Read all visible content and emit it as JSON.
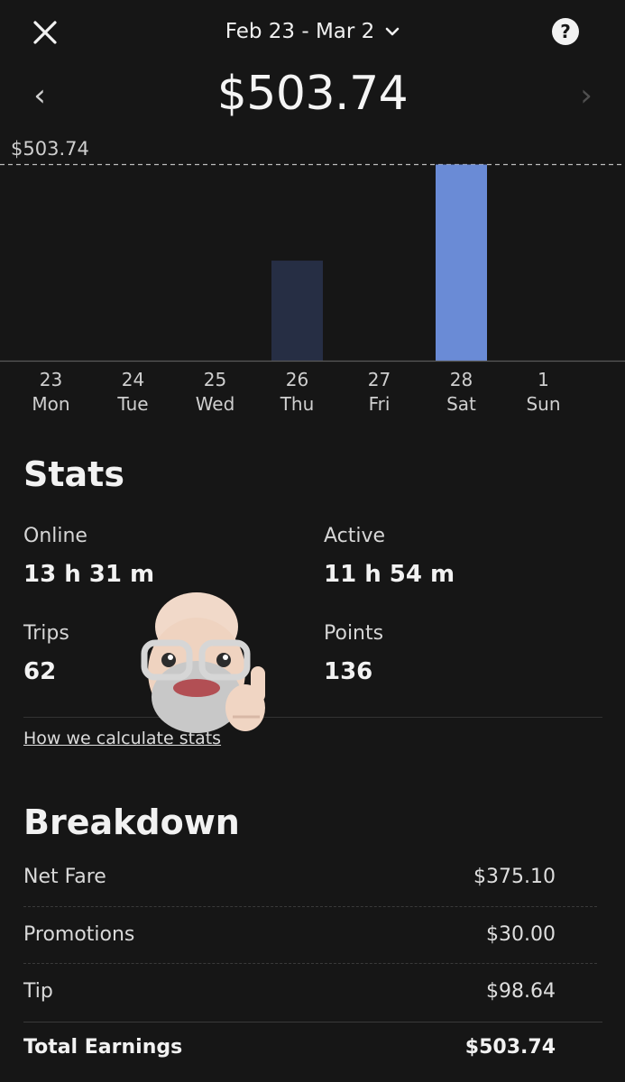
{
  "header": {
    "date_range": "Feb 23 - Mar 2",
    "icons": {
      "close": "close-icon",
      "dropdown": "chevron-down-icon",
      "help": "help-circle-icon"
    }
  },
  "nav": {
    "prev_glyph": "‹",
    "next_glyph": "›"
  },
  "total_earnings": "$503.74",
  "chart_data": {
    "type": "bar",
    "categories": [
      "23 Mon",
      "24 Tue",
      "25 Wed",
      "26 Thu",
      "27 Fri",
      "28 Sat",
      "1 Sun"
    ],
    "days": [
      {
        "num": "23",
        "name": "Mon"
      },
      {
        "num": "24",
        "name": "Tue"
      },
      {
        "num": "25",
        "name": "Wed"
      },
      {
        "num": "26",
        "name": "Thu"
      },
      {
        "num": "27",
        "name": "Fri"
      },
      {
        "num": "28",
        "name": "Sat"
      },
      {
        "num": "1",
        "name": "Sun"
      }
    ],
    "values": [
      0,
      0,
      0,
      257.0,
      0,
      503.74,
      0
    ],
    "max_label": "$503.74",
    "ylim": [
      0,
      503.74
    ],
    "selected_index": 5,
    "colors": {
      "bar": "#262e44",
      "selected": "#6a8bd6",
      "line": "#bdbdbd"
    }
  },
  "stats": {
    "title": "Stats",
    "items": [
      {
        "label": "Online",
        "value": "13 h 31 m"
      },
      {
        "label": "Active",
        "value": "11 h 54 m"
      },
      {
        "label": "Trips",
        "value": "62"
      },
      {
        "label": "Points",
        "value": "136"
      }
    ],
    "link": "How we calculate stats"
  },
  "breakdown": {
    "title": "Breakdown",
    "rows": [
      {
        "label": "Net Fare",
        "amount": "$375.10"
      },
      {
        "label": "Promotions",
        "amount": "$30.00"
      },
      {
        "label": "Tip",
        "amount": "$98.64"
      }
    ],
    "total": {
      "label": "Total Earnings",
      "amount": "$503.74"
    }
  },
  "overlay": {
    "sticker": "memoji-thumbs-up-sticker"
  }
}
